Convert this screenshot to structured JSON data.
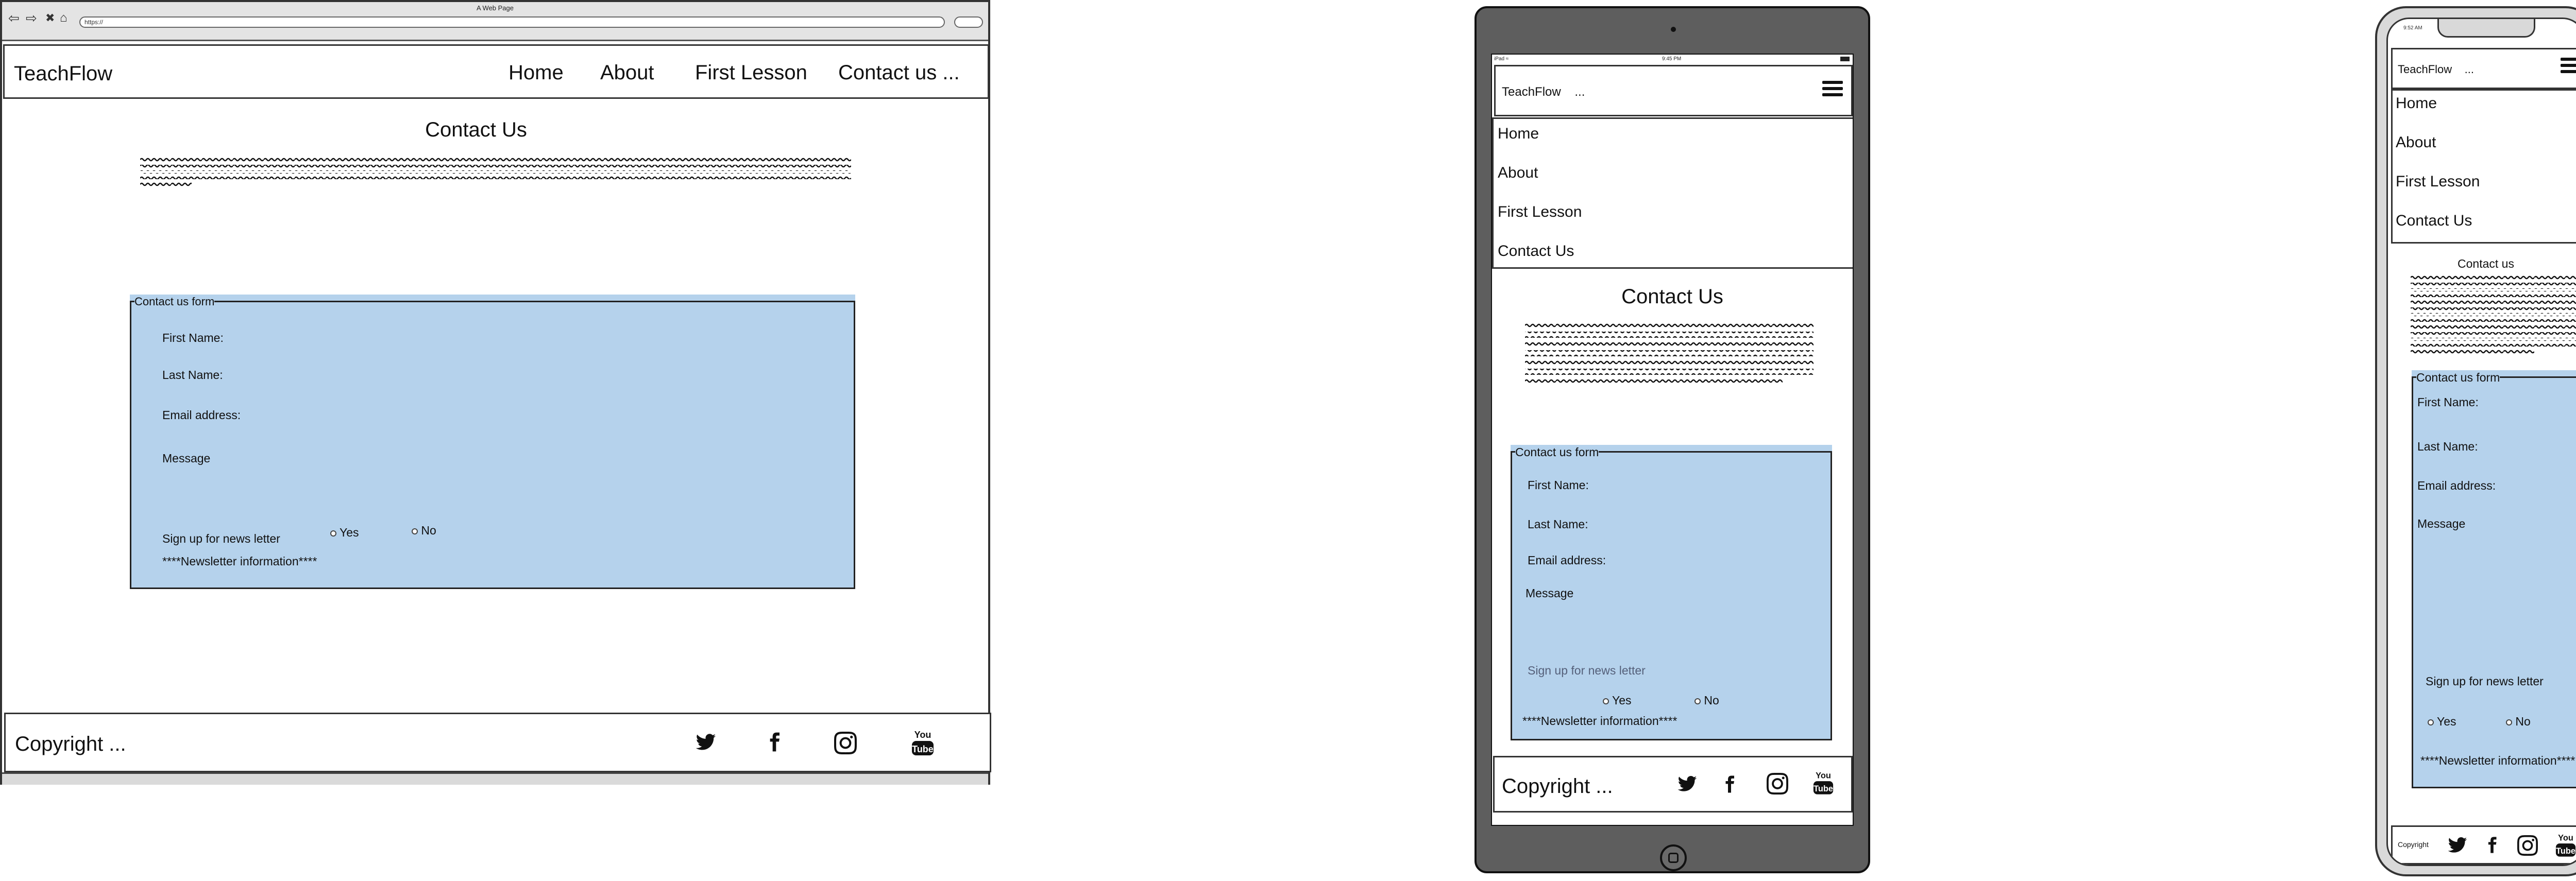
{
  "brand": "TeachFlow",
  "browser": {
    "title": "A Web Page",
    "url": "https://"
  },
  "nav": {
    "home": "Home",
    "about": "About",
    "first_lesson": "First Lesson",
    "contact": "Contact us ...",
    "contact_mobile": "Contact Us"
  },
  "page": {
    "title": "Contact Us",
    "title_phone": "Contact us"
  },
  "form": {
    "legend": "Contact us form",
    "first_name": "First Name:",
    "last_name": "Last Name:",
    "email": "Email address:",
    "message": "Message",
    "newsletter": "Sign up for news letter",
    "yes": "Yes",
    "no": "No",
    "newsletter_info": "****Newsletter information****"
  },
  "footer": {
    "copyright": "Copyright  ...",
    "copyright_phone": "Copyright"
  },
  "icons": {
    "social": [
      "twitter-icon",
      "facebook-icon",
      "instagram-icon",
      "youtube-icon"
    ],
    "youtube_text_top": "You",
    "youtube_text_bottom": "Tube",
    "menu": "hamburger-menu-icon",
    "browser_nav": [
      "back-arrow-icon",
      "forward-arrow-icon",
      "close-icon",
      "home-icon"
    ]
  },
  "tablet": {
    "status_left": "iPad ≈",
    "status_time": "9:45 PM",
    "brand_suffix": "..."
  },
  "phone": {
    "status_time": "9:52 AM",
    "brand_suffix": "..."
  },
  "colors": {
    "form_bg": "#b5d2ec",
    "tablet_frame": "#5e5e5e",
    "phone_frame": "#d9d9d9",
    "newsletter_tablet_text": "#55607a"
  }
}
